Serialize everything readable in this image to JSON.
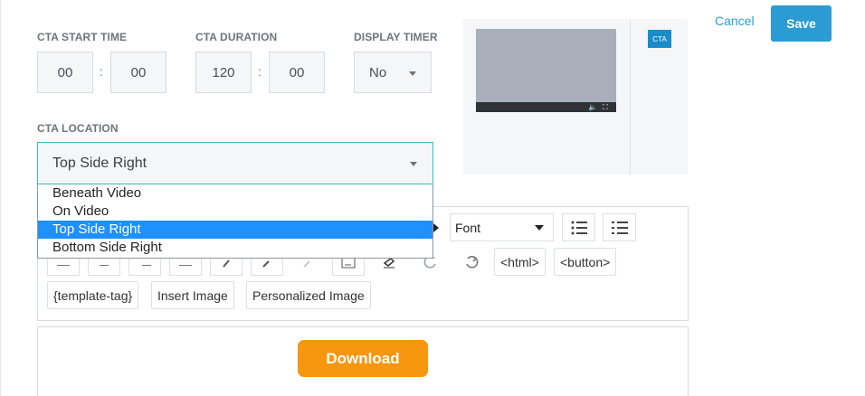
{
  "fields": {
    "start_time_label": "CTA START TIME",
    "start_hours": "00",
    "start_minutes": "00",
    "duration_label": "CTA DURATION",
    "duration_minutes": "120",
    "duration_seconds": "00",
    "display_timer_label": "DISPLAY TIMER",
    "display_timer_value": "No",
    "separator": ":"
  },
  "location": {
    "label": "CTA LOCATION",
    "selected": "Top Side Right",
    "options": [
      "Beneath Video",
      "On Video",
      "Top Side Right",
      "Bottom Side Right"
    ]
  },
  "preview": {
    "cta_badge": "CTA",
    "volume_icon": "🔈",
    "fullscreen_icon": "⛶"
  },
  "actions": {
    "cancel": "Cancel",
    "save": "Save"
  },
  "toolbar": {
    "font_label": "Font",
    "html_label": "<html>",
    "button_label": "<button>",
    "template_tag_label": "{template-tag}",
    "insert_image_label": "Insert Image",
    "personalized_image_label": "Personalized Image"
  },
  "content": {
    "download_label": "Download"
  },
  "colors": {
    "accent": "#2a9bd3",
    "selected_option": "#1e90ff",
    "download": "#f7960f",
    "focus_border": "#3cb8c4"
  }
}
